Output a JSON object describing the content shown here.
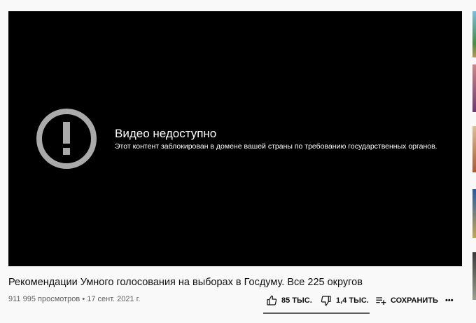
{
  "player": {
    "error_title": "Видео недоступно",
    "error_message": "Этот контент заблокирован в домене вашей страны по требованию государственных органов."
  },
  "video": {
    "title": "Рекомендации Умного голосования на выборах в Госдуму. Все 225 округов",
    "views": "911 995 просмотров",
    "separator": "•",
    "date": "17 сент. 2021 г."
  },
  "actions": {
    "like_count": "85 ТЫС.",
    "dislike_count": "1,4 ТЫС.",
    "save_label": "СОХРАНИТЬ",
    "more_label": "•••"
  },
  "icons": {
    "error": "alert-circle-icon",
    "like": "thumb-up-icon",
    "dislike": "thumb-down-icon",
    "save": "playlist-add-icon"
  },
  "colors": {
    "player_bg": "#000000",
    "page_bg": "#f9f9f9",
    "error_icon": "#aaaaaa"
  }
}
